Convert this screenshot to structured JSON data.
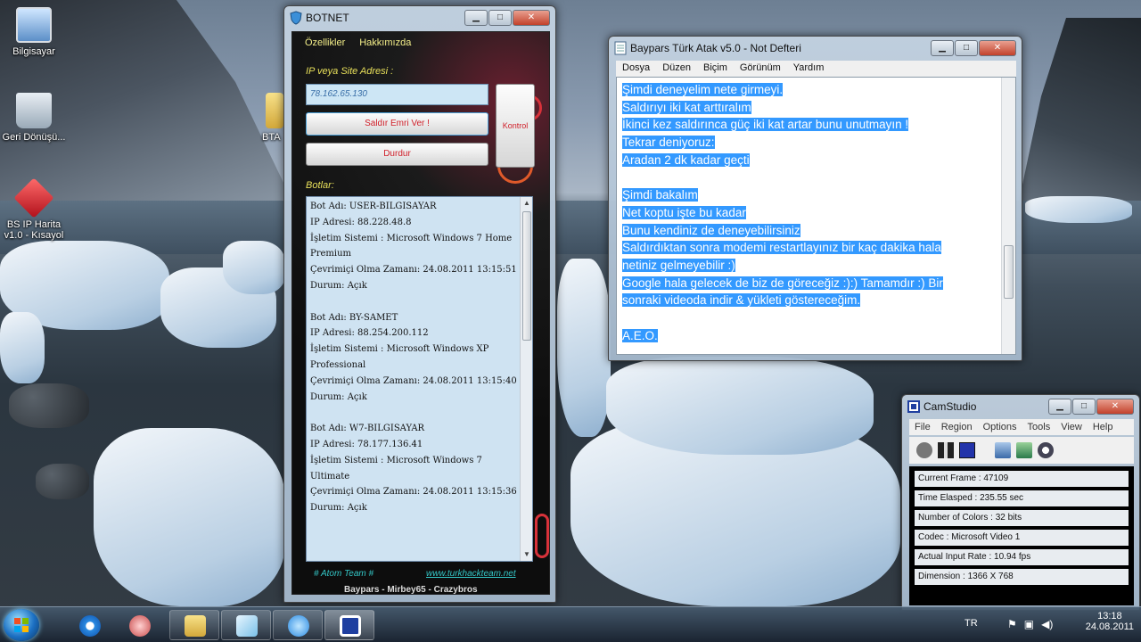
{
  "desktop": {
    "icons": [
      {
        "label": "Bilgisayar"
      },
      {
        "label": "Geri Dönüşü..."
      },
      {
        "label": "BS IP Harita v1.0 - Kısayol"
      },
      {
        "label": "BTA"
      }
    ]
  },
  "botnet": {
    "title": "BOTNET",
    "menu": [
      "Özellikler",
      "Hakkımızda"
    ],
    "ip_label": "IP veya Site Adresi :",
    "ip_value": "78.162.65.130",
    "attack_button": "Saldır Emri Ver  !",
    "stop_button": "Durdur",
    "control_button": "Kontrol",
    "bots_label": "Botlar:",
    "bots": [
      {
        "name": "Bot Adı: USER-BILGISAYAR",
        "ip": "IP Adresi: 88.228.48.8",
        "os": "İşletim Sistemi : Microsoft Windows 7 Home Premium",
        "online": "Çevrimiçi Olma Zamanı: 24.08.2011 13:15:51",
        "status": "Durum: Açık"
      },
      {
        "name": "Bot Adı: BY-SAMET",
        "ip": "IP Adresi: 88.254.200.112",
        "os": "İşletim Sistemi : Microsoft Windows XP Professional",
        "online": "Çevrimiçi Olma Zamanı: 24.08.2011 13:15:40",
        "status": "Durum: Açık"
      },
      {
        "name": "Bot Adı: W7-BILGISAYAR",
        "ip": "IP Adresi: 78.177.136.41",
        "os": "İşletim Sistemi : Microsoft Windows 7 Ultimate",
        "online": "Çevrimiçi Olma Zamanı: 24.08.2011 13:15:36",
        "status": "Durum: Açık"
      }
    ],
    "footer_team": "# Atom Team #",
    "footer_link": "www.turkhackteam.net",
    "footer_credits": "Baypars - Mirbey65 - Crazybros"
  },
  "notepad": {
    "title": "Baypars Türk Atak v5.0 - Not Defteri",
    "menu": [
      "Dosya",
      "Düzen",
      "Biçim",
      "Görünüm",
      "Yardım"
    ],
    "lines": [
      "Şimdi deneyelim nete girmeyi.",
      "Saldırıyı iki kat arttıralım",
      "İkinci kez saldırınca güç iki kat artar bunu unutmayın !",
      "Tekrar deniyoruz:",
      "Aradan 2 dk kadar geçti",
      "",
      "Şimdi bakalım",
      "Net koptu işte bu kadar",
      "Bunu kendiniz de deneyebilirsiniz",
      "Saldırdıktan sonra modemi restartlayınız bir kaç dakika hala",
      "netiniz gelmeyebilir :)",
      "Google hala gelecek de biz de göreceğiz :):) Tamamdır :) Bir",
      "sonraki videoda indir & yükleti göstereceğim.",
      "",
      "A.E.O."
    ]
  },
  "camstudio": {
    "title": "CamStudio",
    "menu": [
      "File",
      "Region",
      "Options",
      "Tools",
      "View",
      "Help"
    ],
    "stats": [
      "Current Frame : 47109",
      "Time Elasped : 235.55 sec",
      "Number of Colors : 32 bits",
      "Codec : Microsoft Video 1",
      "Actual Input Rate : 10.94 fps",
      "Dimension : 1366 X 768"
    ]
  },
  "taskbar": {
    "language": "TR",
    "time": "13:18",
    "date": "24.08.2011"
  }
}
